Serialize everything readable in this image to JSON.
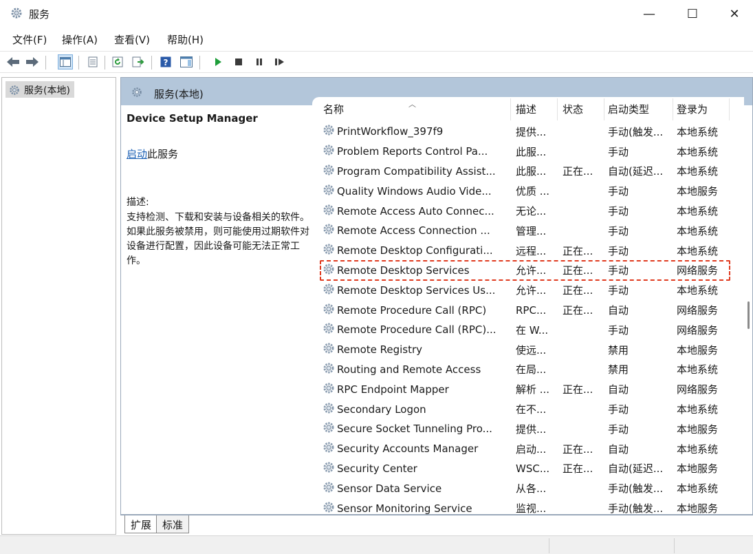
{
  "window": {
    "title": "服务",
    "minimize_glyph": "—",
    "maximize_glyph": "☐",
    "close_glyph": "✕"
  },
  "menu": [
    "文件(F)",
    "操作(A)",
    "查看(V)",
    "帮助(H)"
  ],
  "tree": {
    "root_label": "服务(本地)"
  },
  "pane": {
    "header": "服务(本地)"
  },
  "detail": {
    "service_title": "Device Setup Manager",
    "start_link": "启动",
    "start_suffix": "此服务",
    "desc_label": "描述:",
    "desc_text": "支持检测、下载和安装与设备相关的软件。如果此服务被禁用，则可能使用过期软件对设备进行配置，因此设备可能无法正常工作。"
  },
  "columns": {
    "name": "名称",
    "desc": "描述",
    "status": "状态",
    "startup": "启动类型",
    "logon": "登录为"
  },
  "services": [
    {
      "name": "PrintWorkflow_397f9",
      "desc": "提供...",
      "status": "",
      "startup": "手动(触发...",
      "logon": "本地系统"
    },
    {
      "name": "Problem Reports Control Pa...",
      "desc": "此服...",
      "status": "",
      "startup": "手动",
      "logon": "本地系统"
    },
    {
      "name": "Program Compatibility Assist...",
      "desc": "此服...",
      "status": "正在...",
      "startup": "自动(延迟...",
      "logon": "本地系统"
    },
    {
      "name": "Quality Windows Audio Vide...",
      "desc": "优质 ...",
      "status": "",
      "startup": "手动",
      "logon": "本地服务"
    },
    {
      "name": "Remote Access Auto Connec...",
      "desc": "无论...",
      "status": "",
      "startup": "手动",
      "logon": "本地系统"
    },
    {
      "name": "Remote Access Connection ...",
      "desc": "管理...",
      "status": "",
      "startup": "手动",
      "logon": "本地系统"
    },
    {
      "name": "Remote Desktop Configurati...",
      "desc": "远程...",
      "status": "正在...",
      "startup": "手动",
      "logon": "本地系统"
    },
    {
      "name": "Remote Desktop Services",
      "desc": "允许...",
      "status": "正在...",
      "startup": "手动",
      "logon": "网络服务",
      "highlighted": true
    },
    {
      "name": "Remote Desktop Services Us...",
      "desc": "允许...",
      "status": "正在...",
      "startup": "手动",
      "logon": "本地系统"
    },
    {
      "name": "Remote Procedure Call (RPC)",
      "desc": "RPC...",
      "status": "正在...",
      "startup": "自动",
      "logon": "网络服务"
    },
    {
      "name": "Remote Procedure Call (RPC)...",
      "desc": "在 W...",
      "status": "",
      "startup": "手动",
      "logon": "网络服务"
    },
    {
      "name": "Remote Registry",
      "desc": "使远...",
      "status": "",
      "startup": "禁用",
      "logon": "本地服务"
    },
    {
      "name": "Routing and Remote Access",
      "desc": "在局...",
      "status": "",
      "startup": "禁用",
      "logon": "本地系统"
    },
    {
      "name": "RPC Endpoint Mapper",
      "desc": "解析 ...",
      "status": "正在...",
      "startup": "自动",
      "logon": "网络服务"
    },
    {
      "name": "Secondary Logon",
      "desc": "在不...",
      "status": "",
      "startup": "手动",
      "logon": "本地系统"
    },
    {
      "name": "Secure Socket Tunneling Pro...",
      "desc": "提供...",
      "status": "",
      "startup": "手动",
      "logon": "本地服务"
    },
    {
      "name": "Security Accounts Manager",
      "desc": "启动...",
      "status": "正在...",
      "startup": "自动",
      "logon": "本地系统"
    },
    {
      "name": "Security Center",
      "desc": "WSC...",
      "status": "正在...",
      "startup": "自动(延迟...",
      "logon": "本地服务"
    },
    {
      "name": "Sensor Data Service",
      "desc": "从各...",
      "status": "",
      "startup": "手动(触发...",
      "logon": "本地系统"
    },
    {
      "name": "Sensor Monitoring Service",
      "desc": "监视...",
      "status": "",
      "startup": "手动(触发...",
      "logon": "本地服务"
    }
  ],
  "tabs": [
    "扩展",
    "标准"
  ],
  "colors": {
    "pane_header": "#b3c6da",
    "highlight_border": "#e03a1f",
    "link": "#1a5fb4",
    "play_green": "#1e9e3a"
  }
}
